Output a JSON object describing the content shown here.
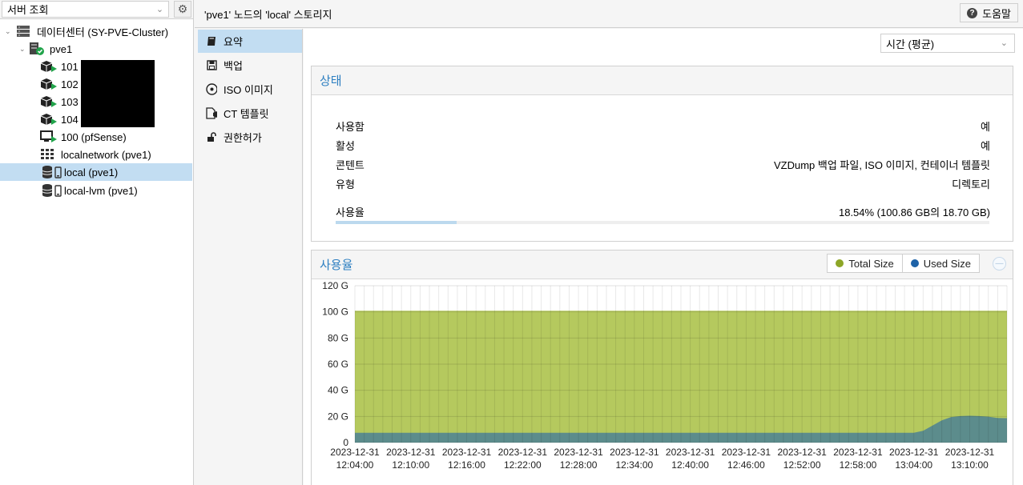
{
  "tree": {
    "view_select": "서버 조회",
    "nodes": [
      {
        "label": "데이터센터 (SY-PVE-Cluster)"
      },
      {
        "label": "pve1"
      },
      {
        "label": "101"
      },
      {
        "label": "102"
      },
      {
        "label": "103"
      },
      {
        "label": "104"
      },
      {
        "label": "100 (pfSense)"
      },
      {
        "label": "localnetwork (pve1)"
      },
      {
        "label": "local (pve1)"
      },
      {
        "label": "local-lvm (pve1)"
      }
    ]
  },
  "header": {
    "title": "'pve1' 노드의 'local' 스토리지",
    "help_label": "도움말"
  },
  "nav": {
    "items": [
      {
        "label": "요약"
      },
      {
        "label": "백업"
      },
      {
        "label": "ISO 이미지"
      },
      {
        "label": "CT 템플릿"
      },
      {
        "label": "권한허가"
      }
    ]
  },
  "main": {
    "time_select": "시간 (평균)",
    "status": {
      "title": "상태",
      "rows": [
        {
          "key": "사용함",
          "value": "예"
        },
        {
          "key": "활성",
          "value": "예"
        },
        {
          "key": "콘텐트",
          "value": "VZDump 백업 파일, ISO 이미지, 컨테이너 템플릿"
        },
        {
          "key": "유형",
          "value": "디렉토리"
        }
      ],
      "usage_label": "사용율",
      "usage_value": "18.54% (100.86 GB의 18.70 GB)",
      "usage_fraction": 0.1854
    },
    "usage": {
      "title": "사용율",
      "legend": [
        {
          "label": "Total Size",
          "color": "#8da627"
        },
        {
          "label": "Used Size",
          "color": "#1e63a8"
        }
      ]
    }
  },
  "chart_data": {
    "type": "area",
    "ylim": [
      0,
      120
    ],
    "y_ticks": [
      "0",
      "20 G",
      "40 G",
      "60 G",
      "80 G",
      "100 G",
      "120 G"
    ],
    "y_tick_values": [
      0,
      20,
      40,
      60,
      80,
      100,
      120
    ],
    "x_ticks": [
      [
        "2023-12-31",
        "12:04:00"
      ],
      [
        "2023-12-31",
        "12:10:00"
      ],
      [
        "2023-12-31",
        "12:16:00"
      ],
      [
        "2023-12-31",
        "12:22:00"
      ],
      [
        "2023-12-31",
        "12:28:00"
      ],
      [
        "2023-12-31",
        "12:34:00"
      ],
      [
        "2023-12-31",
        "12:40:00"
      ],
      [
        "2023-12-31",
        "12:46:00"
      ],
      [
        "2023-12-31",
        "12:52:00"
      ],
      [
        "2023-12-31",
        "12:58:00"
      ],
      [
        "2023-12-31",
        "13:04:00"
      ],
      [
        "2023-12-31",
        "13:10:00"
      ]
    ],
    "x_minutes": [
      0,
      1,
      2,
      3,
      4,
      5,
      6,
      7,
      8,
      9,
      10,
      11,
      12,
      13,
      14,
      15,
      16,
      17,
      18,
      19,
      20,
      21,
      22,
      23,
      24,
      25,
      26,
      27,
      28,
      29,
      30,
      31,
      32,
      33,
      34,
      35,
      36,
      37,
      38,
      39,
      40,
      41,
      42,
      43,
      44,
      45,
      46,
      47,
      48,
      49,
      50,
      51,
      52,
      53,
      54,
      55,
      56,
      57,
      58,
      59,
      60,
      61,
      62,
      63,
      64,
      65,
      66,
      67,
      68,
      69,
      70
    ],
    "series": [
      {
        "name": "Total Size",
        "color": "#b5c95e",
        "values": [
          100.86,
          100.86,
          100.86,
          100.86,
          100.86,
          100.86,
          100.86,
          100.86,
          100.86,
          100.86,
          100.86,
          100.86,
          100.86,
          100.86,
          100.86,
          100.86,
          100.86,
          100.86,
          100.86,
          100.86,
          100.86,
          100.86,
          100.86,
          100.86,
          100.86,
          100.86,
          100.86,
          100.86,
          100.86,
          100.86,
          100.86,
          100.86,
          100.86,
          100.86,
          100.86,
          100.86,
          100.86,
          100.86,
          100.86,
          100.86,
          100.86,
          100.86,
          100.86,
          100.86,
          100.86,
          100.86,
          100.86,
          100.86,
          100.86,
          100.86,
          100.86,
          100.86,
          100.86,
          100.86,
          100.86,
          100.86,
          100.86,
          100.86,
          100.86,
          100.86,
          100.86,
          100.86,
          100.86,
          100.86,
          100.86,
          100.86,
          100.86,
          100.86,
          100.86,
          100.86,
          100.86
        ]
      },
      {
        "name": "Used Size",
        "color": "#5c8c8c",
        "values": [
          7.5,
          7.5,
          7.5,
          7.5,
          7.5,
          7.5,
          7.5,
          7.5,
          7.5,
          7.5,
          7.5,
          7.5,
          7.5,
          7.5,
          7.5,
          7.5,
          7.5,
          7.5,
          7.5,
          7.5,
          7.5,
          7.5,
          7.5,
          7.5,
          7.5,
          7.5,
          7.5,
          7.5,
          7.5,
          7.5,
          7.5,
          7.5,
          7.5,
          7.5,
          7.5,
          7.5,
          7.5,
          7.5,
          7.5,
          7.5,
          7.5,
          7.5,
          7.5,
          7.5,
          7.5,
          7.5,
          7.5,
          7.5,
          7.5,
          7.5,
          7.5,
          7.5,
          7.5,
          7.5,
          7.5,
          7.5,
          7.5,
          7.5,
          7.5,
          7.5,
          7.5,
          9,
          13,
          17,
          19.5,
          20.3,
          20.5,
          20.3,
          19.8,
          18.8,
          18.7
        ]
      }
    ]
  }
}
